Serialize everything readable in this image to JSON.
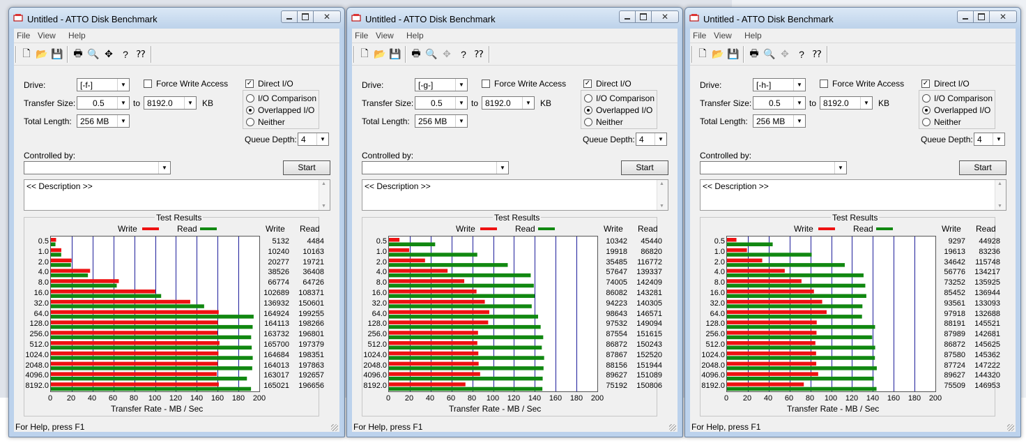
{
  "colors": {
    "write": "#ee1111",
    "read": "#118811",
    "grid": "#1c1c9a",
    "title_bg": "#bcd2ec"
  },
  "windows": [
    {
      "title": "Untitled - ATTO Disk Benchmark",
      "menu": [
        "File",
        "View",
        "Help"
      ],
      "toolbar_icons": [
        "new-icon",
        "open-icon",
        "save-icon",
        "print-icon",
        "print-preview-icon",
        "move-icon",
        "help-icon",
        "context-help-icon"
      ],
      "drive_label": "Drive:",
      "drive": "[-f-]",
      "transfer_label": "Transfer Size:",
      "transfer_from": "0.5",
      "to_label": "to",
      "transfer_to": "8192.0",
      "kb_label": "KB",
      "length_label": "Total Length:",
      "length": "256 MB",
      "force_write_label": "Force Write Access",
      "force_write": false,
      "direct_io_label": "Direct I/O",
      "direct_io": true,
      "radio_io_comparison": "I/O Comparison",
      "radio_overlapped": "Overlapped I/O",
      "radio_neither": "Neither",
      "io_selected": "overlapped",
      "queue_label": "Queue Depth:",
      "queue": "4",
      "controlled_label": "Controlled by:",
      "controlled": "",
      "start_label": "Start",
      "description": "<< Description >>",
      "results_title": "Test Results",
      "write_legend": "Write",
      "read_legend": "Read",
      "col_write": "Write",
      "col_read": "Read",
      "xlabel": "Transfer Rate - MB / Sec",
      "status": "For Help, press F1",
      "chart_data": {
        "type": "bar",
        "orientation": "horizontal",
        "categories": [
          "0.5",
          "1.0",
          "2.0",
          "4.0",
          "8.0",
          "16.0",
          "32.0",
          "64.0",
          "128.0",
          "256.0",
          "512.0",
          "1024.0",
          "2048.0",
          "4096.0",
          "8192.0"
        ],
        "series": [
          {
            "name": "Write",
            "values": [
              5132,
              10240,
              20277,
              38526,
              66774,
              102689,
              136932,
              164924,
              164113,
              163732,
              165700,
              164684,
              164013,
              163017,
              165021
            ]
          },
          {
            "name": "Read",
            "values": [
              4484,
              10163,
              19721,
              36408,
              64726,
              108371,
              150601,
              199255,
              198266,
              196801,
              197379,
              198351,
              197863,
              192657,
              196656
            ]
          }
        ],
        "x_ticks": [
          "0",
          "20",
          "40",
          "60",
          "80",
          "100",
          "120",
          "140",
          "160",
          "180",
          "200"
        ],
        "xlim": [
          0,
          200
        ],
        "value_unit": "KB/s",
        "xlabel": "Transfer Rate - MB / Sec",
        "grid": true,
        "legend": "top"
      }
    },
    {
      "title": "Untitled - ATTO Disk Benchmark",
      "menu": [
        "File",
        "View",
        "Help"
      ],
      "toolbar_icons": [
        "new-icon",
        "open-icon",
        "save-icon",
        "print-icon",
        "print-preview-icon",
        "move-icon",
        "help-icon",
        "context-help-icon"
      ],
      "drive_label": "Drive:",
      "drive": "[-g-]",
      "transfer_label": "Transfer Size:",
      "transfer_from": "0.5",
      "to_label": "to",
      "transfer_to": "8192.0",
      "kb_label": "KB",
      "length_label": "Total Length:",
      "length": "256 MB",
      "force_write_label": "Force Write Access",
      "force_write": false,
      "direct_io_label": "Direct I/O",
      "direct_io": true,
      "radio_io_comparison": "I/O Comparison",
      "radio_overlapped": "Overlapped I/O",
      "radio_neither": "Neither",
      "io_selected": "overlapped",
      "queue_label": "Queue Depth:",
      "queue": "4",
      "controlled_label": "Controlled by:",
      "controlled": "",
      "start_label": "Start",
      "description": "<< Description >>",
      "results_title": "Test Results",
      "write_legend": "Write",
      "read_legend": "Read",
      "col_write": "Write",
      "col_read": "Read",
      "xlabel": "Transfer Rate - MB / Sec",
      "status": "For Help, press F1",
      "chart_data": {
        "type": "bar",
        "orientation": "horizontal",
        "categories": [
          "0.5",
          "1.0",
          "2.0",
          "4.0",
          "8.0",
          "16.0",
          "32.0",
          "64.0",
          "128.0",
          "256.0",
          "512.0",
          "1024.0",
          "2048.0",
          "4096.0",
          "8192.0"
        ],
        "series": [
          {
            "name": "Write",
            "values": [
              10342,
              19918,
              35485,
              57647,
              74005,
              86082,
              94223,
              98643,
              97532,
              87554,
              86872,
              87867,
              88156,
              89627,
              75192
            ]
          },
          {
            "name": "Read",
            "values": [
              45440,
              86820,
              116772,
              139337,
              142409,
              143281,
              140305,
              146571,
              149094,
              151615,
              150243,
              152520,
              151944,
              151089,
              150806
            ]
          }
        ],
        "x_ticks": [
          "0",
          "20",
          "40",
          "60",
          "80",
          "100",
          "120",
          "140",
          "160",
          "180",
          "200"
        ],
        "xlim": [
          0,
          200
        ],
        "value_unit": "KB/s",
        "xlabel": "Transfer Rate - MB / Sec",
        "grid": true,
        "legend": "top"
      }
    },
    {
      "title": "Untitled - ATTO Disk Benchmark",
      "menu": [
        "File",
        "View",
        "Help"
      ],
      "toolbar_icons": [
        "new-icon",
        "open-icon",
        "save-icon",
        "print-icon",
        "print-preview-icon",
        "move-icon",
        "help-icon",
        "context-help-icon"
      ],
      "drive_label": "Drive:",
      "drive": "[-h-]",
      "transfer_label": "Transfer Size:",
      "transfer_from": "0.5",
      "to_label": "to",
      "transfer_to": "8192.0",
      "kb_label": "KB",
      "length_label": "Total Length:",
      "length": "256 MB",
      "force_write_label": "Force Write Access",
      "force_write": false,
      "direct_io_label": "Direct I/O",
      "direct_io": true,
      "radio_io_comparison": "I/O Comparison",
      "radio_overlapped": "Overlapped I/O",
      "radio_neither": "Neither",
      "io_selected": "overlapped",
      "queue_label": "Queue Depth:",
      "queue": "4",
      "controlled_label": "Controlled by:",
      "controlled": "",
      "start_label": "Start",
      "description": "<< Description >>",
      "results_title": "Test Results",
      "write_legend": "Write",
      "read_legend": "Read",
      "col_write": "Write",
      "col_read": "Read",
      "xlabel": "Transfer Rate - MB / Sec",
      "status": "For Help, press F1",
      "chart_data": {
        "type": "bar",
        "orientation": "horizontal",
        "categories": [
          "0.5",
          "1.0",
          "2.0",
          "4.0",
          "8.0",
          "16.0",
          "32.0",
          "64.0",
          "128.0",
          "256.0",
          "512.0",
          "1024.0",
          "2048.0",
          "4096.0",
          "8192.0"
        ],
        "series": [
          {
            "name": "Write",
            "values": [
              9297,
              19613,
              34642,
              56776,
              73252,
              85452,
              93561,
              97918,
              88191,
              87989,
              86872,
              87580,
              87724,
              89627,
              75509
            ]
          },
          {
            "name": "Read",
            "values": [
              44928,
              83236,
              115748,
              134217,
              135925,
              136944,
              133093,
              132688,
              145521,
              142681,
              145625,
              145362,
              147222,
              144320,
              146953
            ]
          }
        ],
        "x_ticks": [
          "0",
          "20",
          "40",
          "60",
          "80",
          "100",
          "120",
          "140",
          "160",
          "180",
          "200"
        ],
        "xlim": [
          0,
          200
        ],
        "value_unit": "KB/s",
        "xlabel": "Transfer Rate - MB / Sec",
        "grid": true,
        "legend": "top"
      }
    }
  ]
}
